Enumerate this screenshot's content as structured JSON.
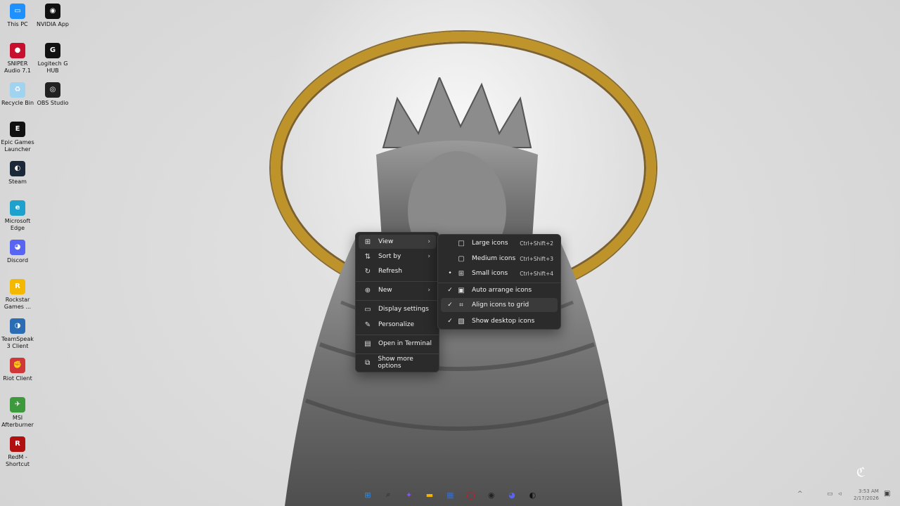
{
  "desktop_icons": [
    {
      "label": "This PC",
      "icon": "monitor-icon",
      "color": "#1e90ff",
      "glyph": "▭"
    },
    {
      "label": "NVIDIA App",
      "icon": "nvidia-icon",
      "color": "#111111",
      "glyph": "◉"
    },
    {
      "label": "SNIPER Audio 7.1",
      "icon": "sniper-audio-icon",
      "color": "#c8102e",
      "glyph": "●"
    },
    {
      "label": "Logitech G HUB",
      "icon": "logitech-icon",
      "color": "#111111",
      "glyph": "G"
    },
    {
      "label": "Recycle Bin",
      "icon": "recycle-bin-icon",
      "color": "#9fd3f0",
      "glyph": "♻"
    },
    {
      "label": "OBS Studio",
      "icon": "obs-icon",
      "color": "#222222",
      "glyph": "◎"
    },
    {
      "label": "Epic Games Launcher",
      "icon": "epic-icon",
      "color": "#111111",
      "glyph": "E"
    },
    {
      "label": "Steam",
      "icon": "steam-icon",
      "color": "#1b2838",
      "glyph": "◐"
    },
    {
      "label": "Microsoft Edge",
      "icon": "edge-icon",
      "color": "#1fa1ce",
      "glyph": "e"
    },
    {
      "label": "Discord",
      "icon": "discord-icon",
      "color": "#5865f2",
      "glyph": "◕"
    },
    {
      "label": "Rockstar Games ...",
      "icon": "rockstar-icon",
      "color": "#f5b800",
      "glyph": "R"
    },
    {
      "label": "TeamSpeak 3 Client",
      "icon": "teamspeak-icon",
      "color": "#2a6db5",
      "glyph": "◑"
    },
    {
      "label": "Riot Client",
      "icon": "riot-icon",
      "color": "#d13639",
      "glyph": "✊"
    },
    {
      "label": "MSI Afterburner",
      "icon": "afterburner-icon",
      "color": "#3c9a3c",
      "glyph": "✈"
    },
    {
      "label": "RedM - Shortcut",
      "icon": "redm-icon",
      "color": "#b01010",
      "glyph": "R"
    }
  ],
  "context_menu": {
    "items": [
      {
        "label": "View",
        "icon": "view-grid-icon",
        "glyph": "⊞",
        "submenu": true
      },
      {
        "label": "Sort by",
        "icon": "sort-icon",
        "glyph": "⇅",
        "submenu": true
      },
      {
        "label": "Refresh",
        "icon": "refresh-icon",
        "glyph": "↻",
        "submenu": false
      },
      {
        "label": "New",
        "icon": "new-icon",
        "glyph": "⊕",
        "submenu": true
      },
      {
        "label": "Display settings",
        "icon": "display-settings-icon",
        "glyph": "▭",
        "submenu": false
      },
      {
        "label": "Personalize",
        "icon": "personalize-icon",
        "glyph": "✎",
        "submenu": false
      },
      {
        "label": "Open in Terminal",
        "icon": "terminal-icon",
        "glyph": "▤",
        "submenu": false
      },
      {
        "label": "Show more options",
        "icon": "more-options-icon",
        "glyph": "⧉",
        "submenu": false
      }
    ]
  },
  "view_submenu": {
    "items": [
      {
        "label": "Large icons",
        "shortcut": "Ctrl+Shift+2",
        "state": "",
        "icon": "large-icons-icon",
        "glyph": "□"
      },
      {
        "label": "Medium icons",
        "shortcut": "Ctrl+Shift+3",
        "state": "",
        "icon": "medium-icons-icon",
        "glyph": "▢"
      },
      {
        "label": "Small icons",
        "shortcut": "Ctrl+Shift+4",
        "state": "•",
        "icon": "small-icons-icon",
        "glyph": "⊞"
      },
      {
        "label": "Auto arrange icons",
        "shortcut": "",
        "state": "✓",
        "icon": "auto-arrange-icon",
        "glyph": "▣"
      },
      {
        "label": "Align icons to grid",
        "shortcut": "",
        "state": "✓",
        "icon": "align-grid-icon",
        "glyph": "⌗"
      },
      {
        "label": "Show desktop icons",
        "shortcut": "",
        "state": "✓",
        "icon": "show-desktop-icons-icon",
        "glyph": "▧"
      }
    ]
  },
  "taskbar": {
    "icons": [
      {
        "name": "start-icon",
        "glyph": "⊞",
        "color": "#1f8fff"
      },
      {
        "name": "search-icon",
        "glyph": "⌕",
        "color": "#222222"
      },
      {
        "name": "copilot-icon",
        "glyph": "✦",
        "color": "#8a4fff"
      },
      {
        "name": "file-explorer-icon",
        "glyph": "▬",
        "color": "#f2b400"
      },
      {
        "name": "store-icon",
        "glyph": "▦",
        "color": "#2f6fd6"
      },
      {
        "name": "opera-icon",
        "glyph": "◯",
        "color": "#d1142a"
      },
      {
        "name": "obs-taskbar-icon",
        "glyph": "◉",
        "color": "#222222"
      },
      {
        "name": "discord-taskbar-icon",
        "glyph": "◕",
        "color": "#5865f2"
      },
      {
        "name": "steam-taskbar-icon",
        "glyph": "◐",
        "color": "#111111"
      }
    ],
    "time": "3:53 AM",
    "date": "2/17/2026"
  }
}
